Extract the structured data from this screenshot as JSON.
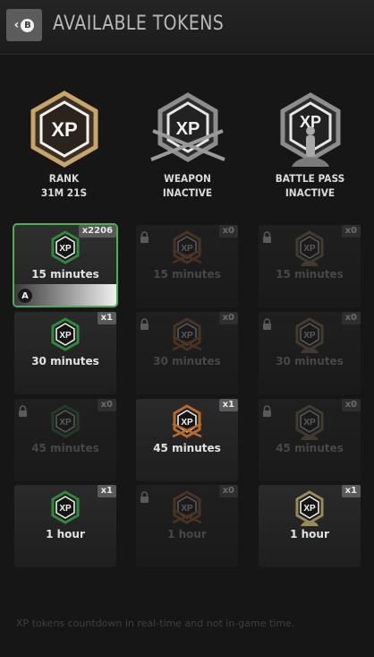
{
  "header": {
    "title": "AVAILABLE TOKENS",
    "back_icon": "chevron-left-icon",
    "back_key": "B"
  },
  "summary": [
    {
      "type": "rank",
      "emblem_text": "XP",
      "label": "RANK",
      "status": "31M 21S",
      "color": "#c9a46a"
    },
    {
      "type": "weapon",
      "emblem_text": "XP",
      "label": "WEAPON",
      "status": "INACTIVE",
      "color": "#9a9a9a"
    },
    {
      "type": "battlepass",
      "emblem_text": "XP",
      "label": "BATTLE PASS",
      "status": "INACTIVE",
      "color": "#9a9a9a"
    }
  ],
  "tokens": [
    {
      "column": "rank",
      "duration": "15 minutes",
      "count": "x2206",
      "locked": false,
      "selected": true,
      "action_key": "A"
    },
    {
      "column": "weapon",
      "duration": "15 minutes",
      "count": "x0",
      "locked": true,
      "selected": false
    },
    {
      "column": "battlepass",
      "duration": "15 minutes",
      "count": "x0",
      "locked": true,
      "selected": false
    },
    {
      "column": "rank",
      "duration": "30 minutes",
      "count": "x1",
      "locked": false,
      "selected": false
    },
    {
      "column": "weapon",
      "duration": "30 minutes",
      "count": "x0",
      "locked": true,
      "selected": false
    },
    {
      "column": "battlepass",
      "duration": "30 minutes",
      "count": "x0",
      "locked": true,
      "selected": false
    },
    {
      "column": "rank",
      "duration": "45 minutes",
      "count": "x0",
      "locked": true,
      "selected": false
    },
    {
      "column": "weapon",
      "duration": "45 minutes",
      "count": "x1",
      "locked": false,
      "selected": false
    },
    {
      "column": "battlepass",
      "duration": "45 minutes",
      "count": "x0",
      "locked": true,
      "selected": false
    },
    {
      "column": "rank",
      "duration": "1 hour",
      "count": "x1",
      "locked": false,
      "selected": false
    },
    {
      "column": "weapon",
      "duration": "1 hour",
      "count": "x0",
      "locked": true,
      "selected": false
    },
    {
      "column": "battlepass",
      "duration": "1 hour",
      "count": "x1",
      "locked": false,
      "selected": false
    }
  ],
  "colors": {
    "rank_token": "#2e8a3c",
    "weapon_token": "#b86a2a",
    "battlepass_token": "#9a8a5a",
    "selected_outline": "#4fae55"
  },
  "footer": {
    "note": "XP tokens countdown in real-time and not in-game time."
  }
}
